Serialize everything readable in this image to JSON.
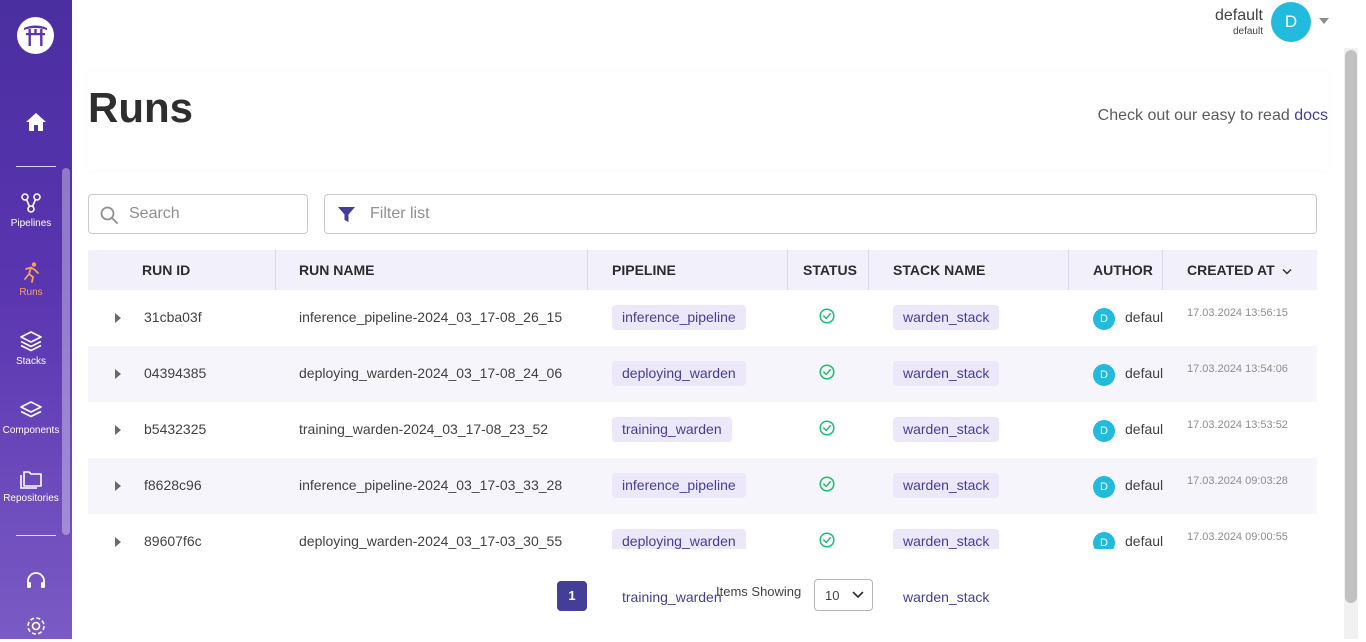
{
  "sidebar": {
    "items": [
      {
        "label": "Pipelines",
        "icon": "pipelines-icon"
      },
      {
        "label": "Runs",
        "icon": "runs-icon",
        "active": true
      },
      {
        "label": "Stacks",
        "icon": "stacks-icon"
      },
      {
        "label": "Components",
        "icon": "components-icon"
      },
      {
        "label": "Repositories",
        "icon": "repositories-icon"
      }
    ],
    "accent_color": "#f5a35b"
  },
  "user": {
    "name": "default",
    "workspace": "default",
    "initial": "D"
  },
  "header": {
    "title": "Runs",
    "docs_text": "Check out our easy to read ",
    "docs_link": "docs"
  },
  "search": {
    "placeholder": "Search"
  },
  "filter": {
    "placeholder": "Filter list"
  },
  "table": {
    "columns": [
      "RUN ID",
      "RUN NAME",
      "PIPELINE",
      "STATUS",
      "STACK NAME",
      "AUTHOR",
      "CREATED AT"
    ],
    "rows": [
      {
        "run_id": "31cba03f",
        "run_name": "inference_pipeline-2024_03_17-08_26_15",
        "pipeline": "inference_pipeline",
        "status": "completed",
        "stack": "warden_stack",
        "author_initial": "D",
        "author": "default",
        "created_at": "17.03.2024 13:56:15"
      },
      {
        "run_id": "04394385",
        "run_name": "deploying_warden-2024_03_17-08_24_06",
        "pipeline": "deploying_warden",
        "status": "completed",
        "stack": "warden_stack",
        "author_initial": "D",
        "author": "default",
        "created_at": "17.03.2024 13:54:06"
      },
      {
        "run_id": "b5432325",
        "run_name": "training_warden-2024_03_17-08_23_52",
        "pipeline": "training_warden",
        "status": "completed",
        "stack": "warden_stack",
        "author_initial": "D",
        "author": "default",
        "created_at": "17.03.2024 13:53:52"
      },
      {
        "run_id": "f8628c96",
        "run_name": "inference_pipeline-2024_03_17-03_33_28",
        "pipeline": "inference_pipeline",
        "status": "completed",
        "stack": "warden_stack",
        "author_initial": "D",
        "author": "default",
        "created_at": "17.03.2024 09:03:28"
      },
      {
        "run_id": "89607f6c",
        "run_name": "deploying_warden-2024_03_17-03_30_55",
        "pipeline": "deploying_warden",
        "status": "completed",
        "stack": "warden_stack",
        "author_initial": "D",
        "author": "default",
        "created_at": "17.03.2024 09:00:55"
      }
    ],
    "hidden_row_peek": {
      "pipeline": "training_warden",
      "stack": "warden_stack"
    }
  },
  "pagination": {
    "current_page": "1",
    "items_label": "Items Showing",
    "per_page": "10"
  }
}
